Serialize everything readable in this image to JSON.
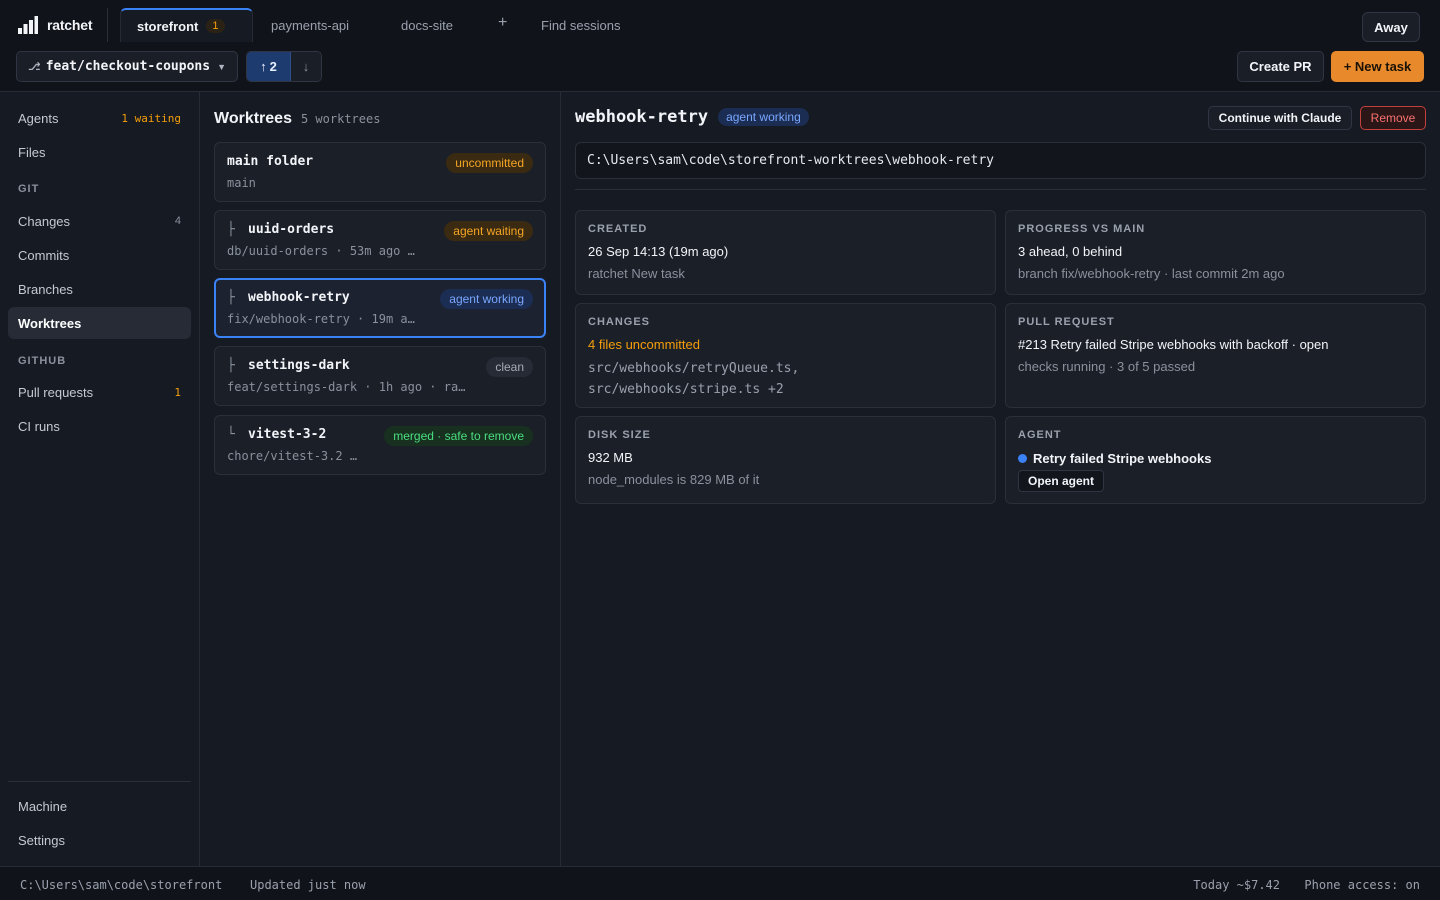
{
  "app": {
    "name": "ratchet"
  },
  "tabs": [
    {
      "label": "storefront",
      "count": "1",
      "active": true
    },
    {
      "label": "payments-api"
    },
    {
      "label": "docs-site"
    }
  ],
  "tab_add": "+",
  "find_sessions": "Find sessions",
  "away_button": "Away",
  "branch": {
    "name": "feat/checkout-coupons"
  },
  "push": {
    "arrow": "↑",
    "count": "2"
  },
  "pull": {
    "arrow": "↓"
  },
  "create_pr": "Create PR",
  "new_task": "+ New task",
  "sidebar": {
    "agents": {
      "label": "Agents",
      "badge": "1 waiting"
    },
    "files": {
      "label": "Files"
    },
    "git_heading": "GIT",
    "changes": {
      "label": "Changes",
      "count": "4"
    },
    "commits": {
      "label": "Commits"
    },
    "branches": {
      "label": "Branches"
    },
    "worktrees": {
      "label": "Worktrees"
    },
    "github_heading": "GITHUB",
    "pull_requests": {
      "label": "Pull requests",
      "count": "1"
    },
    "ci_runs": {
      "label": "CI runs"
    },
    "machine": {
      "label": "Machine"
    },
    "settings": {
      "label": "Settings"
    }
  },
  "worktrees": {
    "title": "Worktrees",
    "count_label": "5 worktrees",
    "items": [
      {
        "glyph": "",
        "name": "main folder",
        "sub": "main",
        "badge": "uncommitted",
        "badge_color": "#f5a524"
      },
      {
        "glyph": "├",
        "name": "uuid-orders",
        "sub": "db/uuid-orders · 53m ago …",
        "badge": "agent waiting",
        "badge_color": "#f5a524"
      },
      {
        "glyph": "├",
        "name": "webhook-retry",
        "sub": "fix/webhook-retry · 19m a…",
        "badge": "agent working",
        "badge_color": "#7aa7ff"
      },
      {
        "glyph": "├",
        "name": "settings-dark",
        "sub": "feat/settings-dark · 1h ago · ra…",
        "badge": "clean",
        "badge_color": "#a5abb6"
      },
      {
        "glyph": "└",
        "name": "vitest-3-2",
        "sub": "chore/vitest-3.2 …",
        "badge": "merged · safe to remove",
        "badge_color": "#4ade80"
      }
    ]
  },
  "detail": {
    "name": "webhook-retry",
    "status": "agent working",
    "continue_button": "Continue with Claude",
    "remove_button": "Remove",
    "path": "C:\\Users\\sam\\code\\storefront-worktrees\\webhook-retry",
    "created": {
      "label": "CREATED",
      "value": "26 Sep 14:13 (19m ago)",
      "sub": "ratchet New task"
    },
    "progress": {
      "label": "PROGRESS VS MAIN",
      "value": "3 ahead, 0 behind",
      "sub": "branch fix/webhook-retry · last commit 2m ago"
    },
    "changes": {
      "label": "CHANGES",
      "value": "4 files uncommitted",
      "files_line1": "src/webhooks/retryQueue.ts,",
      "files_line2": "src/webhooks/stripe.ts +2"
    },
    "pull_request": {
      "label": "PULL REQUEST",
      "value": "#213 Retry failed Stripe webhooks with backoff · open",
      "sub": "checks running · 3 of 5 passed"
    },
    "disk": {
      "label": "DISK SIZE",
      "value": "932 MB",
      "sub": "node_modules is 829 MB of it"
    },
    "agent": {
      "label": "AGENT",
      "name": "Retry failed Stripe webhooks",
      "open_button": "Open agent"
    }
  },
  "status_bar": {
    "path": "C:\\Users\\sam\\code\\storefront",
    "updated": "Updated just now",
    "cost": "Today ~$7.42",
    "phone": "Phone access: on"
  },
  "colors": {
    "accent": "#3b82f6",
    "primary_button": "#e8892b",
    "danger": "#f87171",
    "warning": "#f59e0b",
    "success": "#4ade80"
  }
}
